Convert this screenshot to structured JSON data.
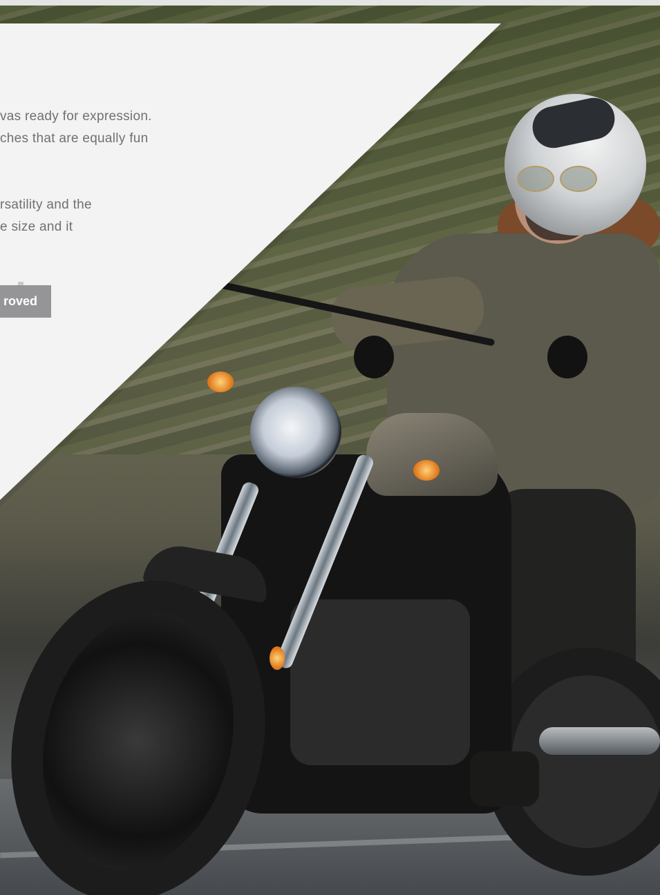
{
  "copy": {
    "paragraph_1_lines": [
      "vas ready for expression.",
      "ches that are equally fun"
    ],
    "paragraph_2_lines": [
      "rsatility and the",
      "e size and it"
    ]
  },
  "button": {
    "label": "roved"
  },
  "photo": {
    "subject": "motorcycle-rider",
    "colors": {
      "panel": "#f2f3f2",
      "button": "#959597",
      "text": "#6f7073"
    }
  }
}
